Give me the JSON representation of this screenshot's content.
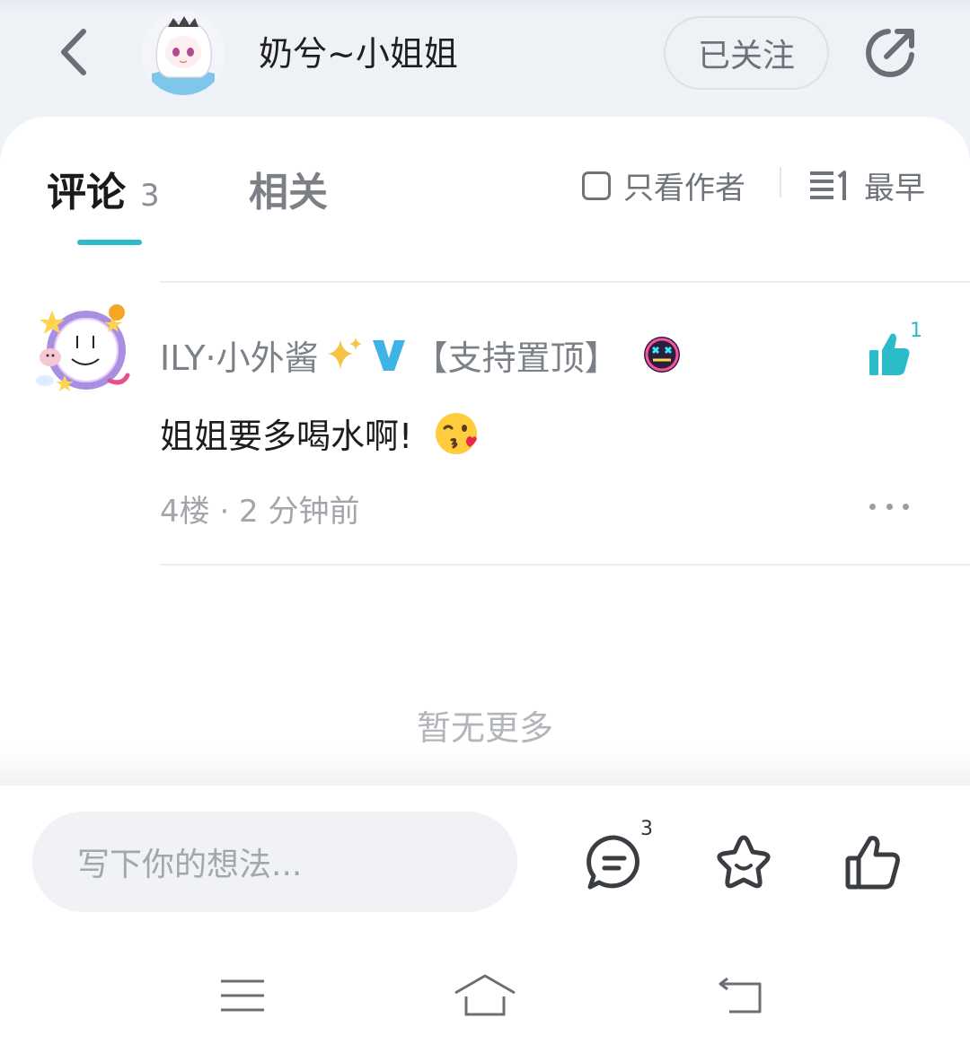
{
  "header": {
    "author_name": "奶兮~小姐姐",
    "follow_label": "已关注",
    "back_icon": "chevron-left-icon",
    "share_icon": "share-icon"
  },
  "tabs": {
    "comments_label": "评论",
    "comments_count": "3",
    "related_label": "相关",
    "author_only_label": "只看作者",
    "sort_label": "最早"
  },
  "comment": {
    "username": "ILY·小外酱",
    "pin_tag": "【支持置顶】",
    "like_count": "1",
    "text": "姐姐要多喝水啊!",
    "meta": "4楼 · 2 分钟前"
  },
  "list": {
    "no_more": "暂无更多"
  },
  "bottom_bar": {
    "input_placeholder": "写下你的想法...",
    "comment_count": "3"
  },
  "colors": {
    "accent": "#2bbbc9",
    "text_primary": "#1f1f1f",
    "text_secondary": "#7c8087"
  }
}
